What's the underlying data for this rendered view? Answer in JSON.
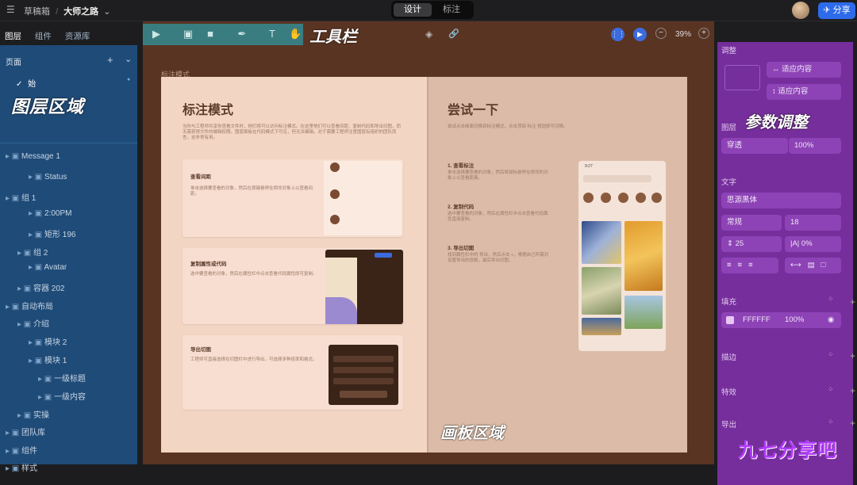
{
  "topbar": {
    "menu_icon": "hamburger-icon",
    "project": "草稿箱",
    "separator": "/",
    "file": "大师之路",
    "mode_design": "设计",
    "mode_annotate": "标注",
    "share": "分享"
  },
  "left": {
    "tab_layers": "图层",
    "tab_components": "组件",
    "tab_assets": "资源库",
    "pages_label": "页面",
    "page_current": "始",
    "area_label": "图层区域",
    "layers": [
      {
        "label": "Message 1"
      },
      {
        "label": "Status"
      },
      {
        "label": "组 1"
      },
      {
        "label": "2:00PM"
      },
      {
        "label": "矩形 196"
      },
      {
        "label": "组 2"
      },
      {
        "label": "Avatar"
      },
      {
        "label": "容器 202"
      },
      {
        "label": "自动布局"
      },
      {
        "label": "介绍"
      },
      {
        "label": "模块 2"
      },
      {
        "label": "模块 1"
      },
      {
        "label": "一级标题"
      },
      {
        "label": "一级内容"
      },
      {
        "label": "实操"
      },
      {
        "label": "团队库"
      },
      {
        "label": "组件"
      },
      {
        "label": "样式"
      }
    ]
  },
  "toolbar": {
    "label": "工具栏",
    "zoom": "39%"
  },
  "canvas": {
    "frame_label": "标注模式",
    "area_label": "画板区域",
    "left_title": "标注模式",
    "left_desc": "当你与工程师共享你查看文件时，他们将可以访问标注模式。在这里他们可以查看间距、复制代码和导出切图，而无需获得文件的编辑权限。图层面板在代码模式下可见，但无法编辑。对于需要工程师注意图层有组织的团队而言，这非常有用。",
    "card1_title": "查看间距",
    "card1_desc": "单击选择要查看的对象，然后在按键悬停在相邻对象上以查看间距。",
    "card2_title": "复制属性或代码",
    "card2_desc": "选中要查看的对象，然后在属性栏中点击查看代码属性即可复制。",
    "card3_title": "导出切图",
    "card3_desc": "工程师可直接选择在切图栏中进行导出，可选择多种倍率和格式。",
    "right_title": "尝试一下",
    "right_desc": "尝试点击画面切换到标注模式，点击顶部 标注 按钮即可切换。",
    "step1_title": "1. 查看标注",
    "step1_desc": "单击选择要查看的对象，然后将鼠标悬停在相邻的对象上以查看距离。",
    "step2_title": "2. 复制代码",
    "step2_desc": "选中要查看的对象，然后在属性栏中点击查看代码属性直接复制。",
    "step3_title": "3. 导出切图",
    "step3_desc": "找到属性栏中的 导出，然后点击 +，根据自己所需对设置导出的倍数，最后导出切图。",
    "phone_time": "9:27"
  },
  "right": {
    "area_label": "参数调整",
    "adjust_label": "调整",
    "fit_w": "适应内容",
    "fit_h": "适应内容",
    "layer_label": "图层",
    "blend": "穿透",
    "opacity": "100%",
    "text_label": "文字",
    "font": "思源黑体",
    "weight": "常规",
    "size": "18",
    "line_height": "25",
    "letter_spacing": "0%",
    "fill_label": "填充",
    "fill_hex": "FFFFFF",
    "fill_opacity": "100%",
    "stroke_label": "描边",
    "effect_label": "特效",
    "export_label": "导出"
  },
  "watermark": "九七分享吧"
}
